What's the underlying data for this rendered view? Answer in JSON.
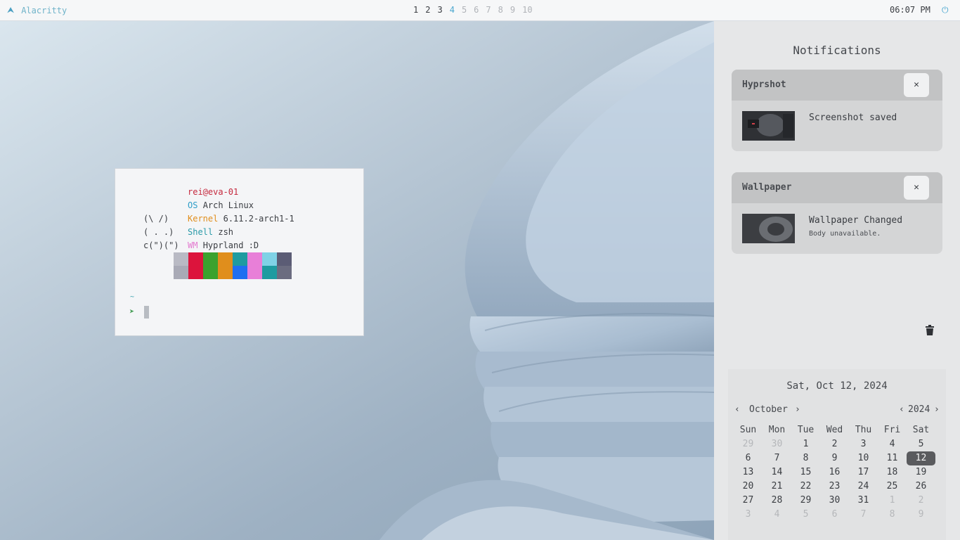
{
  "topbar": {
    "app_icon": "arch-a-icon",
    "app_title": "Alacritty",
    "workspaces": [
      "1",
      "2",
      "3",
      "4",
      "5",
      "6",
      "7",
      "8",
      "9",
      "10"
    ],
    "occupied_workspaces": [
      "1",
      "2",
      "3"
    ],
    "active_workspace": "4",
    "clock": "06:07 PM",
    "power_icon": "power-icon"
  },
  "terminal": {
    "user_host": "rei@eva-01",
    "ascii": [
      "(\\ /)",
      "( . .)",
      "c(\")(\")"
    ],
    "os_label": "OS",
    "os_value": "Arch Linux",
    "kernel_label": "Kernel",
    "kernel_value": "6.11.2-arch1-1",
    "shell_label": "Shell",
    "shell_value": "zsh",
    "wm_label": "WM",
    "wm_value": "Hyprland :D",
    "palette_top": [
      "#b9bac4",
      "#dc143c",
      "#3ba22e",
      "#e08e1c",
      "#1e9ba0",
      "#e87fd8",
      "#7fd2e6",
      "#5b5c75"
    ],
    "palette_bottom": [
      "#a9aab6",
      "#dc143c",
      "#3ba22e",
      "#e08e1c",
      "#1f6ff0",
      "#e87fd8",
      "#1e9ba0",
      "#6b6c80"
    ],
    "cwd": "~",
    "prompt": "➤"
  },
  "panel": {
    "title": "Notifications",
    "notifications": [
      {
        "app": "Hyprshot",
        "summary": "Screenshot saved",
        "body": "",
        "close": "✕"
      },
      {
        "app": "Wallpaper",
        "summary": "Wallpaper Changed",
        "body": "Body unavailable.",
        "close": "✕"
      }
    ],
    "clear_icon": "trash-icon"
  },
  "calendar": {
    "date_label": "Sat, Oct 12, 2024",
    "month": "October",
    "year": "2024",
    "prev": "‹",
    "next": "›",
    "weekdays": [
      "Sun",
      "Mon",
      "Tue",
      "Wed",
      "Thu",
      "Fri",
      "Sat"
    ],
    "days": [
      [
        "29",
        "30",
        "1",
        "2",
        "3",
        "4",
        "5"
      ],
      [
        "6",
        "7",
        "8",
        "9",
        "10",
        "11",
        "12"
      ],
      [
        "13",
        "14",
        "15",
        "16",
        "17",
        "18",
        "19"
      ],
      [
        "20",
        "21",
        "22",
        "23",
        "24",
        "25",
        "26"
      ],
      [
        "27",
        "28",
        "29",
        "30",
        "31",
        "1",
        "2"
      ],
      [
        "3",
        "4",
        "5",
        "6",
        "7",
        "8",
        "9"
      ]
    ],
    "muted": [
      [
        0,
        0
      ],
      [
        0,
        1
      ],
      [
        4,
        5
      ],
      [
        4,
        6
      ],
      [
        5,
        0
      ],
      [
        5,
        1
      ],
      [
        5,
        2
      ],
      [
        5,
        3
      ],
      [
        5,
        4
      ],
      [
        5,
        5
      ],
      [
        5,
        6
      ]
    ],
    "today": [
      1,
      6
    ]
  },
  "colors": {
    "accent": "#4aa7cf",
    "panel_bg": "#e6e7e8",
    "notification_bg": "#d4d5d6"
  }
}
